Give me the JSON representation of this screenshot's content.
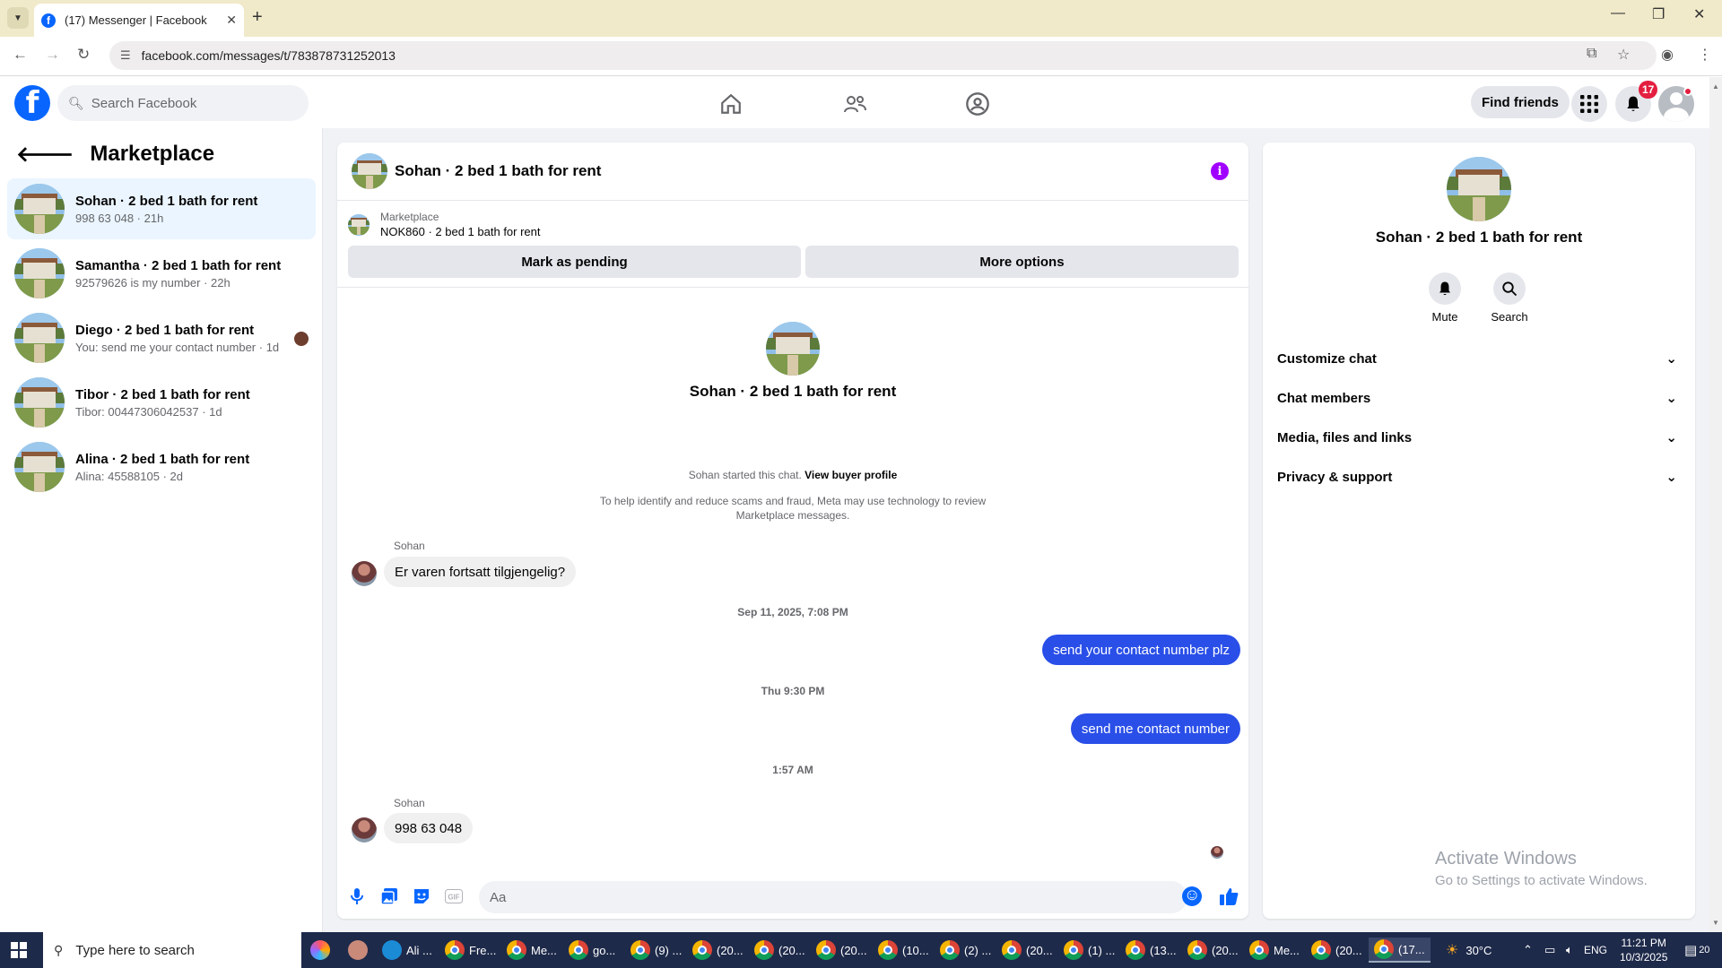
{
  "browser": {
    "tab_title": "(17) Messenger | Facebook",
    "url": "facebook.com/messages/t/783878731252013"
  },
  "header": {
    "search_placeholder": "Search Facebook",
    "find_friends": "Find friends",
    "notification_count": "17"
  },
  "sidebar": {
    "title": "Marketplace",
    "conversations": [
      {
        "name": "Sohan · 2 bed 1 bath for rent",
        "snippet": "998 63 048 · 21h",
        "active": true
      },
      {
        "name": "Samantha · 2 bed 1 bath for rent",
        "snippet": "92579626 is my number · 22h"
      },
      {
        "name": "Diego · 2 bed 1 bath for rent",
        "snippet": "You: send me your contact number · 1d"
      },
      {
        "name": "Tibor · 2 bed 1 bath for rent",
        "snippet": "Tibor: 00447306042537 · 1d"
      },
      {
        "name": "Alina · 2 bed 1 bath for rent",
        "snippet": "Alina: 45588105 · 2d"
      }
    ]
  },
  "chat": {
    "title": "Sohan · 2 bed 1 bath for rent",
    "marketplace_label": "Marketplace",
    "listing": "NOK860 · 2 bed 1 bath for rent",
    "mark_pending": "Mark as pending",
    "more_options": "More options",
    "intro_name": "Sohan · 2 bed 1 bath for rent",
    "started_text": "Sohan started this chat.",
    "view_profile": "View buyer profile",
    "fraud_line1": "To help identify and reduce scams and fraud, Meta may use technology to review",
    "fraud_line2": "Marketplace messages.",
    "sender_name": "Sohan",
    "msg1": "Er varen fortsatt tilgjengelig?",
    "ts1": "Sep 11, 2025, 7:08 PM",
    "msg2": "send your contact number plz",
    "ts2": "Thu 9:30 PM",
    "msg3": "send me contact number",
    "ts3": "1:57 AM",
    "msg4": "998 63 048",
    "composer_placeholder": "Aa"
  },
  "right_panel": {
    "name": "Sohan · 2 bed 1 bath for rent",
    "mute": "Mute",
    "search": "Search",
    "rows": [
      "Customize chat",
      "Chat members",
      "Media, files and links",
      "Privacy & support"
    ]
  },
  "watermark": {
    "line1": "Activate Windows",
    "line2": "Go to Settings to activate Windows."
  },
  "taskbar": {
    "search_placeholder": "Type here to search",
    "apps": [
      "Ali ...",
      "Fre...",
      "Me...",
      "go...",
      "(9) ...",
      "(20...",
      "(20...",
      "(20...",
      "(10...",
      "(2) ...",
      "(20...",
      "(1) ...",
      "(13...",
      "(20...",
      "Me...",
      "(20...",
      "(17..."
    ],
    "weather": "30°C",
    "lang": "ENG",
    "time": "11:21 PM",
    "date": "10/3/2025",
    "notif_count": "20"
  },
  "colors": {
    "fb_blue": "#0866ff",
    "bubble_out": "#2a4fe8",
    "active_row": "#ebf5ff"
  }
}
